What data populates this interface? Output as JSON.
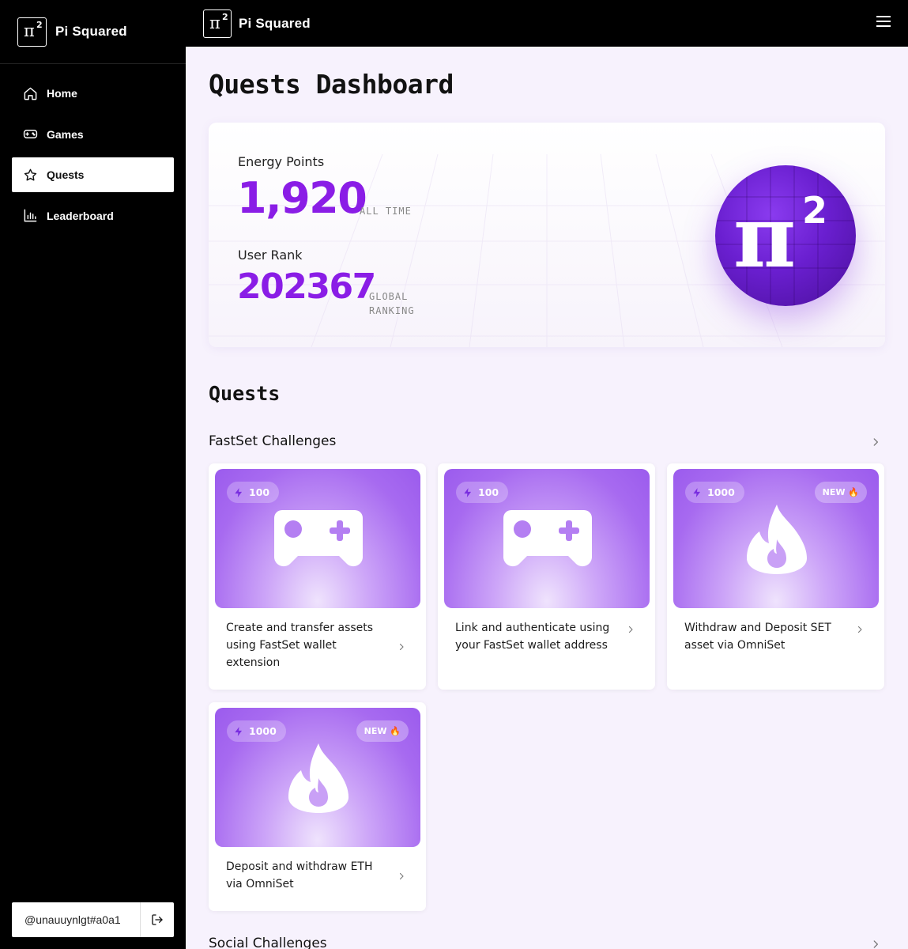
{
  "app": {
    "brand_symbol": "π",
    "brand_superscript": "2",
    "brand_name": "Pi Squared"
  },
  "sidebar": {
    "items": [
      {
        "label": "Home",
        "icon": "home-icon",
        "active": false
      },
      {
        "label": "Games",
        "icon": "gamepad-icon",
        "active": false
      },
      {
        "label": "Quests",
        "icon": "star-icon",
        "active": true
      },
      {
        "label": "Leaderboard",
        "icon": "bar-chart-icon",
        "active": false
      }
    ],
    "username": "@unauuynlgt#a0a1",
    "logout_icon": "logout-icon"
  },
  "header": {
    "menu_icon": "hamburger-menu-icon"
  },
  "main": {
    "page_title": "Quests Dashboard",
    "stats": {
      "energy_label": "Energy Points",
      "energy_value": "1,920",
      "energy_sub": "ALL TIME",
      "rank_label": "User Rank",
      "rank_value": "202367",
      "rank_sub_line1": "GLOBAL",
      "rank_sub_line2": "RANKING"
    },
    "quests_title": "Quests",
    "groups": [
      {
        "title": "FastSet Challenges",
        "quests": [
          {
            "points": "100",
            "new": false,
            "new_label": "",
            "icon": "gamepad-icon",
            "text": "Create and transfer assets using FastSet wallet extension"
          },
          {
            "points": "100",
            "new": false,
            "new_label": "",
            "icon": "gamepad-icon",
            "text": "Link and authenticate using your FastSet wallet address"
          },
          {
            "points": "1000",
            "new": true,
            "new_label": "NEW 🔥",
            "icon": "flame-icon",
            "text": "Withdraw and Deposit SET asset via OmniSet"
          },
          {
            "points": "1000",
            "new": true,
            "new_label": "NEW 🔥",
            "icon": "flame-icon",
            "text": "Deposit and withdraw ETH via OmniSet"
          }
        ]
      },
      {
        "title": "Social Challenges",
        "quests": []
      }
    ]
  },
  "colors": {
    "accent": "#8a1de6",
    "sidebar_bg": "#000000",
    "page_bg": "#f7f2fd"
  }
}
